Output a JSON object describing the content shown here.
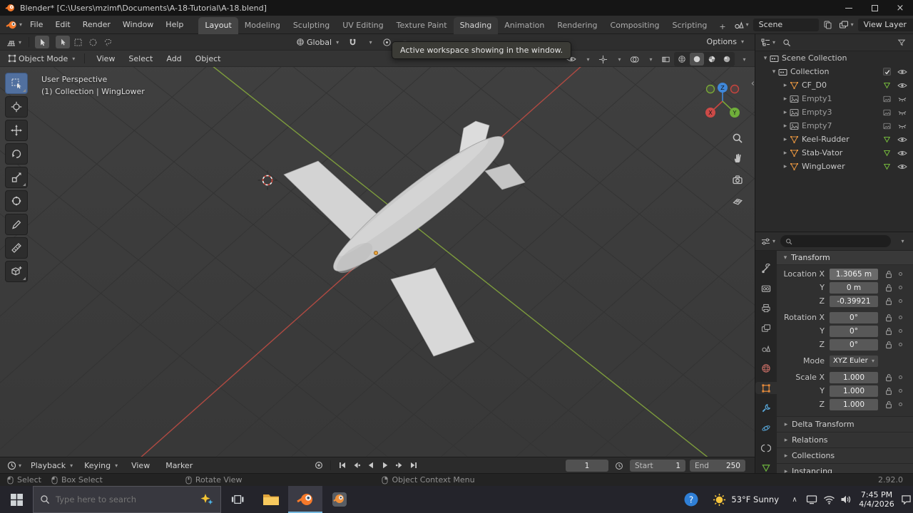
{
  "colors": {
    "blender_orange": "#e87d0d",
    "axis_x": "#c8453f",
    "axis_y": "#7d9c3c",
    "axis_z": "#3f87d9",
    "active_tool": "#51709f",
    "taskbar_active_underline": "#76b9e0"
  },
  "icons": {
    "caret_down": "▾",
    "expand_right": "▸",
    "expand_down": "▾",
    "chevron_up": "∧",
    "chevron_left": "‹",
    "close": "×",
    "plus": "+"
  },
  "title_bar": {
    "title": "Blender* [C:\\Users\\mzimf\\Documents\\A-18-Tutorial\\A-18.blend]"
  },
  "top_bar": {
    "menus": [
      "File",
      "Edit",
      "Render",
      "Window",
      "Help"
    ],
    "workspaces": [
      "Layout",
      "Modeling",
      "Sculpting",
      "UV Editing",
      "Texture Paint",
      "Shading",
      "Animation",
      "Rendering",
      "Compositing",
      "Scripting"
    ],
    "add_workspace": "+",
    "scene_name": "Scene",
    "view_layer_name": "View Layer"
  },
  "viewport_header": {
    "orientation": "Global",
    "options_label": "Options",
    "mode": "Object Mode",
    "menus": [
      "View",
      "Select",
      "Add",
      "Object"
    ]
  },
  "tooltip": {
    "text": "Active workspace showing in the window."
  },
  "viewport": {
    "view_label": "User Perspective",
    "context_label": "(1) Collection | WingLower",
    "gizmo": {
      "x": "X",
      "y": "Y",
      "z": "Z"
    }
  },
  "outliner": {
    "scene_collection": "Scene Collection",
    "collection": "Collection",
    "items": [
      {
        "name": "CF_D0",
        "type": "mesh"
      },
      {
        "name": "Empty1",
        "type": "empty"
      },
      {
        "name": "Empty3",
        "type": "empty"
      },
      {
        "name": "Empty7",
        "type": "empty"
      },
      {
        "name": "Keel-Rudder",
        "type": "mesh"
      },
      {
        "name": "Stab-Vator",
        "type": "mesh"
      },
      {
        "name": "WingLower",
        "type": "mesh"
      }
    ]
  },
  "properties": {
    "transform_title": "Transform",
    "location": [
      {
        "label": "Location X",
        "value": "1.3065 m"
      },
      {
        "label": "Y",
        "value": "0 m"
      },
      {
        "label": "Z",
        "value": "-0.39921"
      }
    ],
    "rotation": [
      {
        "label": "Rotation X",
        "value": "0°"
      },
      {
        "label": "Y",
        "value": "0°"
      },
      {
        "label": "Z",
        "value": "0°"
      }
    ],
    "mode_label": "Mode",
    "mode_value": "XYZ Euler",
    "scale": [
      {
        "label": "Scale X",
        "value": "1.000"
      },
      {
        "label": "Y",
        "value": "1.000"
      },
      {
        "label": "Z",
        "value": "1.000"
      }
    ],
    "sections": [
      "Delta Transform",
      "Relations",
      "Collections",
      "Instancing"
    ]
  },
  "timeline": {
    "menus": [
      "Playback",
      "Keying",
      "View",
      "Marker"
    ],
    "current_frame": "1",
    "start_label": "Start",
    "start_value": "1",
    "end_label": "End",
    "end_value": "250"
  },
  "status_bar": {
    "hints": [
      "Select",
      "Box Select",
      "Rotate View",
      "Object Context Menu"
    ],
    "version": "2.92.0"
  },
  "taskbar": {
    "search_placeholder": "Type here to search",
    "weather": "53°F Sunny",
    "time": "7:45 PM",
    "date": "4/4/2026"
  }
}
